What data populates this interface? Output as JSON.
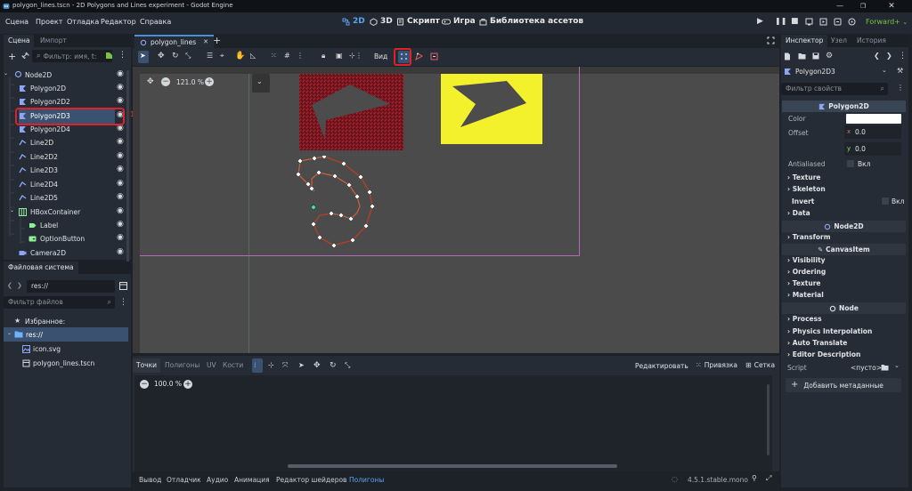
{
  "window": {
    "title": "polygon_lines.tscn - 2D Polygons and Lines experiment - Godot Engine"
  },
  "menu": [
    "Сцена",
    "Проект",
    "Отладка",
    "Редактор",
    "Справка"
  ],
  "workspaces": {
    "w2d": "2D",
    "w3d": "3D",
    "script": "Скрипт",
    "game": "Игра",
    "assetlib": "Библиотека ассетов"
  },
  "renderer": "Forward+",
  "scene_dock": {
    "tabs": [
      "Сцена",
      "Импорт"
    ],
    "filter_placeholder": "Фильтр: имя, t:",
    "nodes": [
      {
        "label": "Node2D",
        "icon": "node2d-icon"
      },
      {
        "label": "Polygon2D",
        "icon": "polygon2d-icon"
      },
      {
        "label": "Polygon2D2",
        "icon": "polygon2d-icon"
      },
      {
        "label": "Polygon2D3",
        "icon": "polygon2d-icon"
      },
      {
        "label": "Polygon2D4",
        "icon": "polygon2d-icon"
      },
      {
        "label": "Line2D",
        "icon": "line2d-icon"
      },
      {
        "label": "Line2D2",
        "icon": "line2d-icon"
      },
      {
        "label": "Line2D3",
        "icon": "line2d-icon"
      },
      {
        "label": "Line2D4",
        "icon": "line2d-icon"
      },
      {
        "label": "Line2D5",
        "icon": "line2d-icon"
      },
      {
        "label": "HBoxContainer",
        "icon": "hbox-icon"
      },
      {
        "label": "Label",
        "icon": "label-icon"
      },
      {
        "label": "OptionButton",
        "icon": "optionbutton-icon"
      },
      {
        "label": "Camera2D",
        "icon": "camera-icon"
      }
    ],
    "annotation": "1"
  },
  "filesystem_dock": {
    "tab": "Файловая система",
    "path": "res://",
    "filter_placeholder": "Фильтр файлов",
    "favorites": "Избранное:",
    "root": "res://",
    "files": [
      "icon.svg",
      "polygon_lines.tscn"
    ]
  },
  "editor": {
    "scene_tab": "polygon_lines",
    "view_label": "Вид",
    "zoom": "121.0 %",
    "accent_color": "#4a8fd8",
    "highlight_color": "#e0202a"
  },
  "polygon_editor": {
    "tabs": [
      "Точки",
      "Полигоны",
      "UV",
      "Кости"
    ],
    "edit_label": "Редактировать",
    "snap_label": "Привязка",
    "grid_label": "Сетка",
    "zoom": "100.0 %"
  },
  "bottom_panel": {
    "tabs": [
      "Вывод",
      "Отладчик",
      "Аудио",
      "Анимация",
      "Редактор шейдеров",
      "Полигоны"
    ],
    "version": "4.5.1.stable.mono"
  },
  "inspector": {
    "tabs": [
      "Инспектор",
      "Узел",
      "История"
    ],
    "object": "Polygon2D3",
    "filter_placeholder": "Фильтр свойств",
    "class_header": "Polygon2D",
    "color_label": "Color",
    "offset_label": "Offset",
    "offset_x": "0.0",
    "offset_y": "0.0",
    "antialiased_label": "Antialiased",
    "antialiased_value": "Вкл",
    "texture": "Texture",
    "skeleton": "Skeleton",
    "invert_label": "Invert",
    "invert_value": "Вкл",
    "data": "Data",
    "node2d_header": "Node2D",
    "transform": "Transform",
    "canvasitem_header": "CanvasItem",
    "visibility": "Visibility",
    "ordering": "Ordering",
    "texture2": "Texture",
    "material": "Material",
    "node_header": "Node",
    "process": "Process",
    "physics": "Physics Interpolation",
    "auto_translate": "Auto Translate",
    "editor_desc": "Editor Description",
    "script_label": "Script",
    "script_value": "<пусто>",
    "add_metadata": "Добавить метаданные"
  }
}
